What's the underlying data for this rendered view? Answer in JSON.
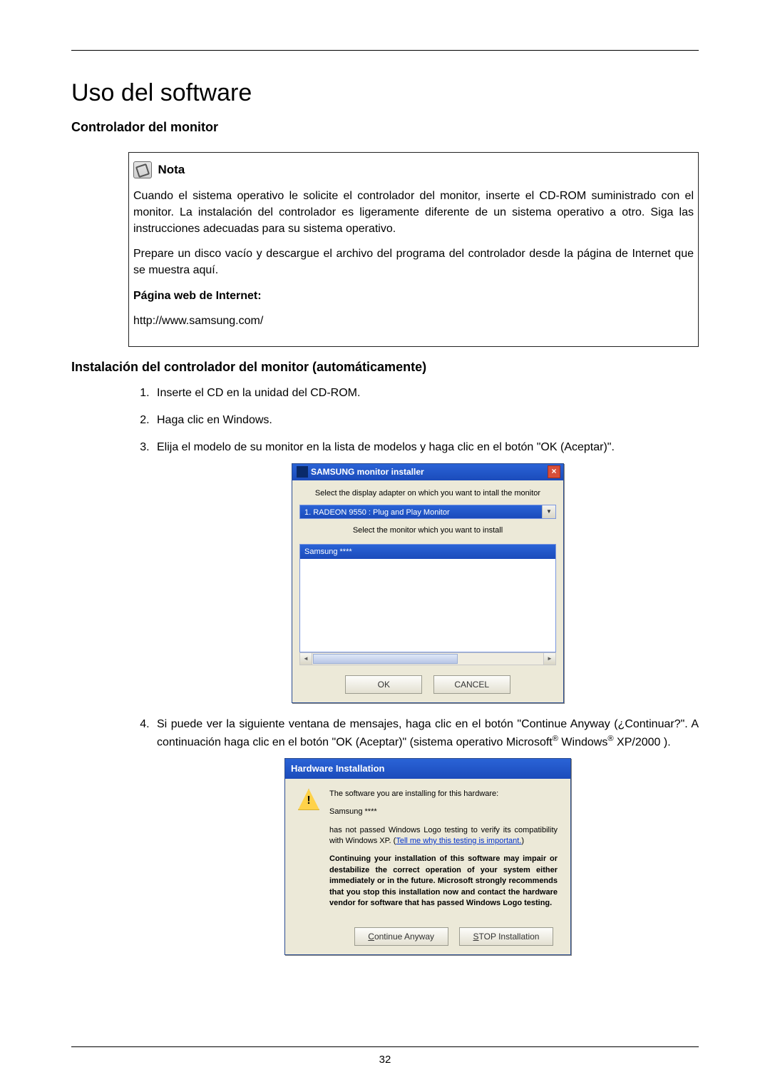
{
  "page_number": "32",
  "title": "Uso del software",
  "section_heading": "Controlador del monitor",
  "note": {
    "label": "Nota",
    "para1": "Cuando el sistema operativo le solicite el controlador del monitor, inserte el CD-ROM suministrado con el monitor. La instalación del controlador es ligeramente diferente de un sistema operativo a otro. Siga las instrucciones adecuadas para su sistema operativo.",
    "para2": "Prepare un disco vacío y descargue el archivo del programa del controlador desde la página de Internet que se muestra aquí.",
    "internet_label": "Página web de Internet:",
    "url": "http://www.samsung.com/"
  },
  "subsection_heading": "Instalación del controlador del monitor (automáticamente)",
  "steps": {
    "s1": "Inserte el CD en la unidad del CD-ROM.",
    "s2": "Haga clic en Windows.",
    "s3": "Elija el modelo de su monitor en la lista de modelos y haga clic en el botón \"OK (Aceptar)\".",
    "s4_a": "Si puede ver la siguiente ventana de mensajes, haga clic en el botón \"Continue Anyway (¿Continuar?\". A continuación haga clic en el botón \"OK (Aceptar)\" (sistema operativo Microsoft",
    "s4_b": " Windows",
    "s4_c": " XP/2000 )."
  },
  "dialog1": {
    "title": "SAMSUNG monitor installer",
    "instr1": "Select the display adapter on which you want to intall the monitor",
    "adapter": "1. RADEON 9550 : Plug and Play Monitor",
    "instr2": "Select the monitor which you want to install",
    "selected_monitor": "Samsung ****",
    "ok": "OK",
    "cancel": "CANCEL",
    "close": "×"
  },
  "dialog2": {
    "title": "Hardware Installation",
    "line1": "The software you are installing for this hardware:",
    "line2": "Samsung ****",
    "line3a": "has not passed Windows Logo testing to verify its compatibility with Windows XP. (",
    "line3_link": "Tell me why this testing is important.",
    "line3b": ")",
    "warn": "Continuing your installation of this software may impair or destabilize the correct operation of your system either immediately or in the future. Microsoft strongly recommends that you stop this installation now and contact the hardware vendor for software that has passed Windows Logo testing.",
    "continue": "Continue Anyway",
    "stop": "STOP Installation"
  }
}
